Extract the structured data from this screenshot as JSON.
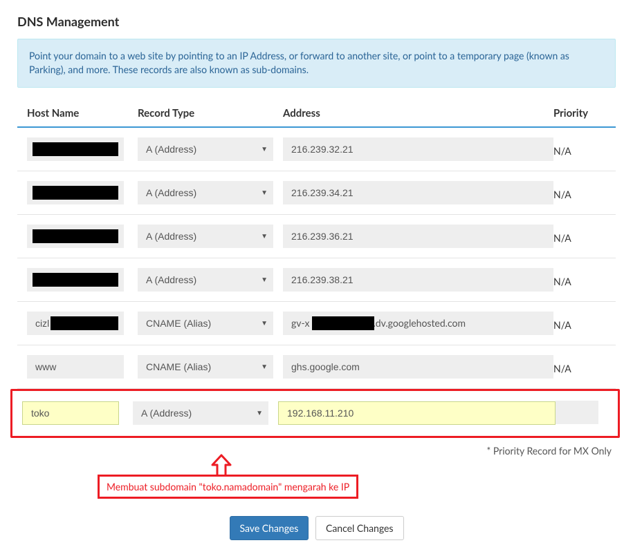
{
  "title": "DNS Management",
  "info_text": "Point your domain to a web site by pointing to an IP Address, or forward to another site, or point to a temporary page (known as Parking), and more. These records are also known as sub-domains.",
  "columns": {
    "host": "Host Name",
    "type": "Record Type",
    "addr": "Address",
    "prio": "Priority"
  },
  "record_types": {
    "a": "A (Address)",
    "cname": "CNAME (Alias)"
  },
  "rows": [
    {
      "host": "",
      "type_key": "a",
      "addr": "216.239.32.21",
      "prio": "N/A",
      "redact_host": true
    },
    {
      "host": "",
      "type_key": "a",
      "addr": "216.239.34.21",
      "prio": "N/A",
      "redact_host": true
    },
    {
      "host": "",
      "type_key": "a",
      "addr": "216.239.36.21",
      "prio": "N/A",
      "redact_host": true
    },
    {
      "host": "",
      "type_key": "a",
      "addr": "216.239.38.21",
      "prio": "N/A",
      "redact_host": true
    },
    {
      "host": "cizl",
      "type_key": "cname",
      "addr_left": "gv-x",
      "addr_right": ".dv.googlehosted.com",
      "prio": "N/A",
      "redact_addr_mid": true
    },
    {
      "host": "www",
      "type_key": "cname",
      "addr": "ghs.google.com",
      "prio": "N/A"
    }
  ],
  "active_row": {
    "host": "toko",
    "type_key": "a",
    "addr": "192.168.11.210",
    "prio": ""
  },
  "footer_note": "* Priority Record for MX Only",
  "annotation": "Membuat subdomain \"toko.namadomain\" mengarah ke IP",
  "buttons": {
    "save": "Save Changes",
    "cancel": "Cancel Changes"
  }
}
